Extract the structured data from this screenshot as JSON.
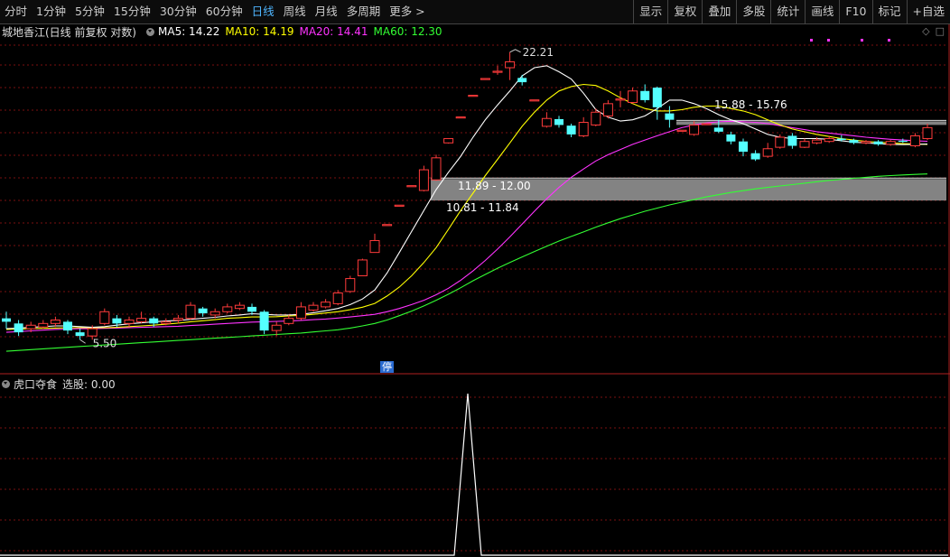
{
  "toolbar": {
    "periods": [
      "分时",
      "1分钟",
      "5分钟",
      "15分钟",
      "30分钟",
      "60分钟",
      "日线",
      "周线",
      "月线",
      "多周期",
      "更多 >"
    ],
    "active": "日线",
    "right_buttons": [
      "显示",
      "复权",
      "叠加",
      "多股",
      "统计",
      "画线",
      "F10",
      "标记",
      "+自选"
    ]
  },
  "main_legend": {
    "title": "城地香江(日线 前复权 对数)",
    "ma5": "MA5: 14.22",
    "ma10": "MA10: 14.19",
    "ma20": "MA20: 14.41",
    "ma60": "MA60: 12.30"
  },
  "sub_legend": {
    "title": "虎口夺食",
    "value": "选股: 0.00"
  },
  "stop_badge": "停",
  "colors": {
    "up": "#ff3b3b",
    "down": "#54ffff",
    "ma5": "#ffffff",
    "ma10": "#ffff00",
    "ma20": "#ff33ff",
    "ma60": "#33ff33",
    "grid": "#7a1010",
    "active_tab": "#4fb6ff",
    "zone": "#9a9a9a"
  },
  "chart_data": {
    "type": "candlestick",
    "scale": "log",
    "labels": {
      "high": "22.21",
      "low": "5.50",
      "zone_upper": "15.88 - 15.76",
      "zone_mid": "11.89 - 12.00",
      "zone_lower": "10.81 - 11.84"
    },
    "zones": [
      {
        "from": 15.76,
        "to": 15.88,
        "start": 55
      },
      {
        "from": 10.81,
        "to": 12.0,
        "start": 35
      }
    ],
    "candles": [
      [
        6.1,
        6.0,
        6.3,
        5.8
      ],
      [
        5.95,
        5.7,
        6.05,
        5.6
      ],
      [
        5.8,
        5.9,
        6.0,
        5.7
      ],
      [
        5.85,
        5.95,
        6.05,
        5.8
      ],
      [
        5.95,
        6.05,
        6.15,
        5.85
      ],
      [
        6.0,
        5.75,
        6.05,
        5.65
      ],
      [
        5.7,
        5.6,
        5.8,
        5.5
      ],
      [
        5.6,
        5.8,
        5.9,
        5.5
      ],
      [
        5.95,
        6.3,
        6.4,
        5.9
      ],
      [
        6.1,
        5.95,
        6.2,
        5.85
      ],
      [
        5.95,
        6.05,
        6.15,
        5.85
      ],
      [
        6.0,
        6.1,
        6.3,
        5.95
      ],
      [
        6.1,
        5.95,
        6.15,
        5.85
      ],
      [
        5.95,
        6.0,
        6.1,
        5.9
      ],
      [
        6.05,
        6.1,
        6.2,
        5.95
      ],
      [
        6.1,
        6.5,
        6.6,
        6.05
      ],
      [
        6.4,
        6.25,
        6.45,
        6.15
      ],
      [
        6.2,
        6.3,
        6.4,
        6.1
      ],
      [
        6.3,
        6.45,
        6.55,
        6.25
      ],
      [
        6.4,
        6.5,
        6.6,
        6.35
      ],
      [
        6.45,
        6.3,
        6.55,
        6.2
      ],
      [
        6.3,
        5.75,
        6.35,
        5.65
      ],
      [
        5.75,
        5.9,
        6.0,
        5.6
      ],
      [
        5.95,
        6.1,
        6.2,
        5.9
      ],
      [
        6.1,
        6.45,
        6.6,
        6.05
      ],
      [
        6.35,
        6.5,
        6.6,
        6.3
      ],
      [
        6.45,
        6.6,
        6.7,
        6.4
      ],
      [
        6.55,
        6.9,
        7.0,
        6.5
      ],
      [
        6.95,
        7.4,
        7.5,
        6.9
      ],
      [
        7.5,
        8.1,
        8.15,
        7.5
      ],
      [
        8.4,
        8.9,
        9.2,
        8.4
      ],
      [
        9.6,
        9.62,
        9.62,
        9.6
      ],
      [
        10.55,
        10.57,
        10.57,
        10.55
      ],
      [
        11.6,
        11.62,
        11.62,
        11.6
      ],
      [
        11.35,
        12.55,
        12.8,
        11.3
      ],
      [
        11.95,
        13.3,
        13.5,
        11.9
      ],
      [
        14.3,
        14.6,
        14.6,
        14.25
      ],
      [
        16.2,
        16.22,
        16.22,
        16.2
      ],
      [
        18.0,
        18.02,
        18.02,
        18.0
      ],
      [
        19.5,
        19.55,
        19.55,
        19.45
      ],
      [
        20.2,
        20.25,
        20.8,
        19.9
      ],
      [
        20.6,
        21.2,
        22.21,
        19.4
      ],
      [
        19.6,
        19.2,
        19.9,
        18.9
      ],
      [
        17.6,
        17.62,
        17.62,
        17.6
      ],
      [
        15.5,
        16.1,
        16.6,
        15.4
      ],
      [
        16.05,
        15.6,
        16.3,
        15.4
      ],
      [
        15.55,
        14.9,
        15.7,
        14.7
      ],
      [
        14.8,
        15.8,
        16.2,
        14.7
      ],
      [
        15.6,
        16.6,
        16.9,
        15.5
      ],
      [
        16.3,
        17.3,
        17.6,
        16.1
      ],
      [
        17.6,
        17.7,
        18.4,
        17.0
      ],
      [
        17.4,
        18.4,
        18.7,
        17.3
      ],
      [
        18.4,
        17.6,
        19.0,
        17.4
      ],
      [
        18.7,
        17.0,
        18.8,
        16.0
      ],
      [
        16.5,
        16.0,
        17.1,
        15.4
      ],
      [
        15.2,
        15.21,
        15.21,
        15.2
      ],
      [
        14.9,
        15.6,
        15.9,
        14.8
      ],
      [
        15.7,
        15.7,
        15.7,
        15.6
      ],
      [
        15.4,
        15.1,
        16.0,
        15.0
      ],
      [
        14.9,
        14.4,
        15.1,
        14.2
      ],
      [
        14.4,
        13.7,
        14.6,
        13.4
      ],
      [
        13.6,
        13.2,
        13.8,
        13.1
      ],
      [
        13.4,
        13.9,
        14.3,
        13.3
      ],
      [
        14.0,
        14.7,
        14.9,
        13.9
      ],
      [
        14.8,
        14.1,
        15.0,
        13.9
      ],
      [
        14.0,
        14.4,
        14.6,
        13.95
      ],
      [
        14.3,
        14.5,
        14.7,
        14.2
      ],
      [
        14.4,
        14.6,
        14.8,
        14.3
      ],
      [
        14.6,
        14.5,
        14.85,
        14.4
      ],
      [
        14.5,
        14.3,
        14.6,
        14.2
      ],
      [
        14.3,
        14.4,
        14.5,
        14.2
      ],
      [
        14.4,
        14.2,
        14.5,
        14.1
      ],
      [
        14.2,
        14.4,
        14.5,
        14.1
      ],
      [
        14.45,
        14.4,
        14.6,
        14.3
      ],
      [
        14.1,
        14.8,
        15.0,
        14.0
      ],
      [
        14.6,
        15.4,
        15.7,
        14.5
      ]
    ],
    "ma5": [
      5.8,
      5.82,
      5.84,
      5.86,
      5.88,
      5.88,
      5.86,
      5.84,
      5.86,
      5.9,
      5.94,
      5.97,
      6.0,
      6.02,
      6.04,
      6.07,
      6.1,
      6.13,
      6.17,
      6.2,
      6.24,
      6.22,
      6.2,
      6.2,
      6.22,
      6.27,
      6.33,
      6.4,
      6.52,
      6.7,
      7.0,
      7.6,
      8.4,
      9.3,
      10.3,
      11.4,
      12.4,
      13.4,
      14.7,
      16.0,
      17.2,
      18.4,
      19.8,
      20.6,
      20.8,
      20.2,
      19.5,
      18.2,
      16.8,
      16.2,
      15.9,
      16.0,
      16.3,
      16.9,
      17.6,
      17.6,
      17.3,
      16.9,
      16.4,
      16.0,
      15.7,
      15.3,
      14.9,
      14.7,
      14.6,
      14.6,
      14.6,
      14.55,
      14.45,
      14.35,
      14.3,
      14.25,
      14.2,
      14.18,
      14.2,
      14.22
    ],
    "ma10": [
      5.78,
      5.79,
      5.8,
      5.81,
      5.82,
      5.83,
      5.83,
      5.83,
      5.83,
      5.84,
      5.86,
      5.88,
      5.9,
      5.93,
      5.96,
      6.0,
      6.03,
      6.06,
      6.1,
      6.12,
      6.14,
      6.14,
      6.15,
      6.17,
      6.19,
      6.22,
      6.26,
      6.3,
      6.36,
      6.44,
      6.56,
      6.8,
      7.1,
      7.5,
      8.0,
      8.6,
      9.4,
      10.3,
      11.2,
      12.2,
      13.2,
      14.3,
      15.5,
      16.6,
      17.6,
      18.4,
      18.8,
      19.0,
      18.9,
      18.4,
      17.8,
      17.3,
      16.9,
      16.7,
      16.7,
      16.8,
      17.0,
      17.1,
      17.1,
      16.9,
      16.7,
      16.4,
      16.0,
      15.6,
      15.3,
      15.1,
      14.9,
      14.75,
      14.6,
      14.5,
      14.4,
      14.35,
      14.3,
      14.25,
      14.22,
      14.19
    ],
    "ma20": [
      5.7,
      5.72,
      5.74,
      5.76,
      5.78,
      5.79,
      5.8,
      5.8,
      5.81,
      5.82,
      5.83,
      5.84,
      5.85,
      5.86,
      5.87,
      5.89,
      5.91,
      5.93,
      5.95,
      5.97,
      5.99,
      6.0,
      6.01,
      6.02,
      6.04,
      6.06,
      6.08,
      6.11,
      6.14,
      6.18,
      6.22,
      6.3,
      6.4,
      6.52,
      6.66,
      6.84,
      7.06,
      7.34,
      7.68,
      8.08,
      8.54,
      9.06,
      9.64,
      10.26,
      10.9,
      11.52,
      12.1,
      12.6,
      13.1,
      13.5,
      13.85,
      14.2,
      14.5,
      14.8,
      15.1,
      15.4,
      15.6,
      15.75,
      15.85,
      15.88,
      15.85,
      15.8,
      15.7,
      15.55,
      15.4,
      15.25,
      15.1,
      15.0,
      14.9,
      14.8,
      14.7,
      14.62,
      14.55,
      14.5,
      14.45,
      14.41
    ],
    "ma60": [
      5.2,
      5.22,
      5.24,
      5.26,
      5.28,
      5.3,
      5.32,
      5.34,
      5.36,
      5.38,
      5.4,
      5.42,
      5.44,
      5.46,
      5.48,
      5.5,
      5.52,
      5.54,
      5.56,
      5.58,
      5.6,
      5.62,
      5.64,
      5.66,
      5.68,
      5.71,
      5.74,
      5.77,
      5.82,
      5.88,
      5.95,
      6.05,
      6.18,
      6.32,
      6.48,
      6.66,
      6.86,
      7.08,
      7.32,
      7.55,
      7.78,
      8.0,
      8.22,
      8.44,
      8.66,
      8.88,
      9.08,
      9.28,
      9.5,
      9.7,
      9.9,
      10.08,
      10.26,
      10.42,
      10.58,
      10.72,
      10.86,
      11.0,
      11.12,
      11.24,
      11.34,
      11.44,
      11.52,
      11.6,
      11.68,
      11.76,
      11.84,
      11.92,
      11.98,
      12.04,
      12.1,
      12.16,
      12.2,
      12.24,
      12.27,
      12.3
    ],
    "signal": {
      "peak_index": 35,
      "value": 1,
      "base": 0
    }
  }
}
